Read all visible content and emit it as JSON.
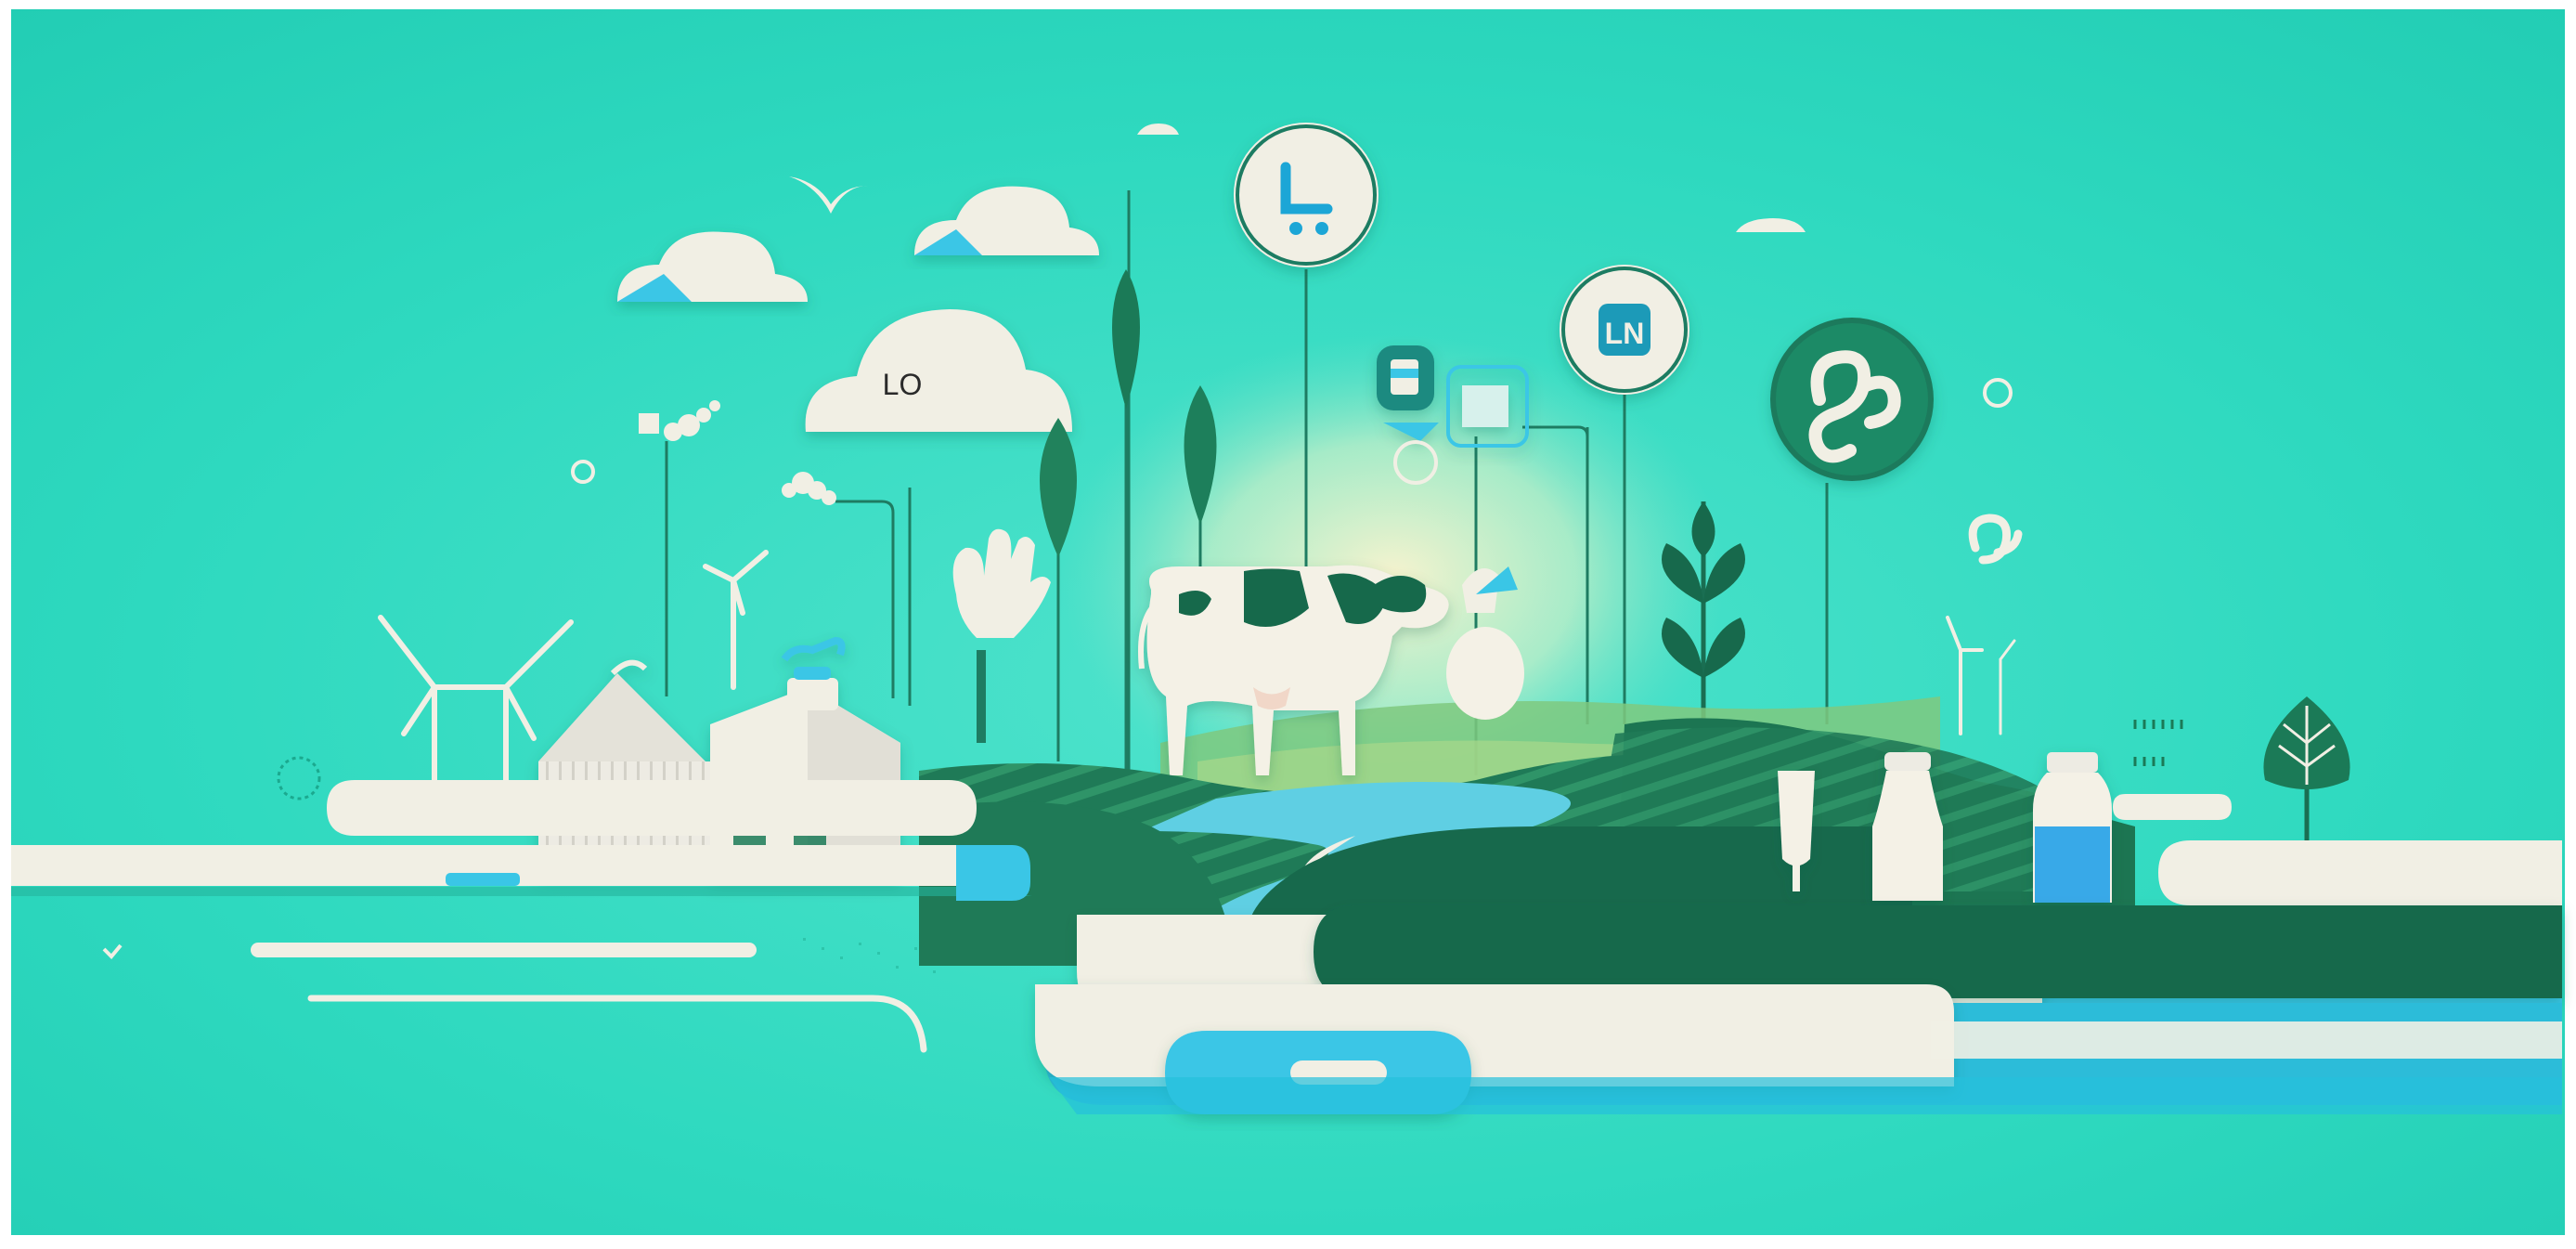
{
  "scene": {
    "cloud_label": "LO",
    "badge_cart_glyph": "L",
    "badge_milk_label": "LN"
  },
  "icons": {
    "badge_cart": "cart-icon",
    "badge_milk": "milk-carton-icon",
    "badge_knot": "knot-logo-icon",
    "small_knot": "knot-icon"
  },
  "colors": {
    "background": "#2ED9BF",
    "background_light": "#6FE6D3",
    "dark_green": "#17694C",
    "mid_green": "#2E8C62",
    "cream": "#F1EFE4",
    "cyan": "#3AC6E6",
    "milk_blue": "#38A9E8",
    "sky_glow": "#F5EEC8"
  }
}
